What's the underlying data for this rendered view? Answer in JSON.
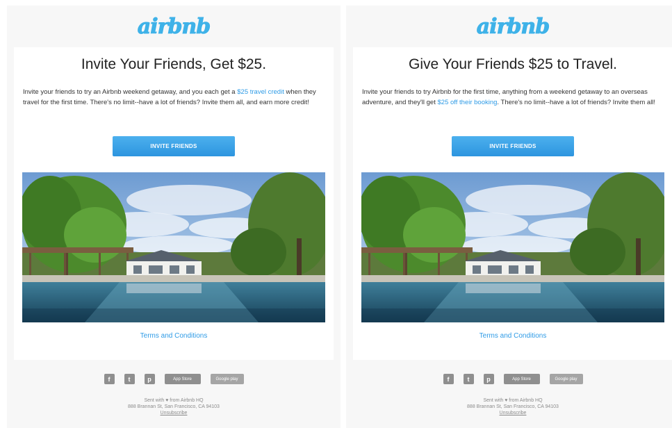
{
  "brand": {
    "logo_text": "airbnb",
    "color": "#3fb2e8",
    "link_color": "#2e9be6",
    "button_color": "#3aa2e6"
  },
  "emails": [
    {
      "headline": "Invite Your Friends, Get $25.",
      "body_before": "Invite your friends to try an Airbnb weekend getaway, and you each get a ",
      "body_link": "$25 travel credit",
      "body_after": " when they travel for the first time. There's no limit--have a lot of friends? Invite them all, and earn more credit!",
      "button_label": "INVITE FRIENDS",
      "terms_label": "Terms and Conditions"
    },
    {
      "headline": "Give Your Friends $25 to Travel.",
      "body_before": "Invite your friends to try Airbnb for the first time, anything from a weekend getaway to an overseas adventure, and they'll get ",
      "body_link": "$25 off their booking",
      "body_after": ". There's no limit--have a lot of friends? Invite them all!",
      "button_label": "INVITE FRIENDS",
      "terms_label": "Terms and Conditions"
    }
  ],
  "footer": {
    "social_icons": [
      "facebook-icon",
      "twitter-icon",
      "pinterest-icon"
    ],
    "facebook_glyph": "f",
    "twitter_glyph": "t",
    "pinterest_glyph": "p",
    "app_store_label": "App Store",
    "google_play_label": "Google play",
    "sent_line": "Sent with ♥ from Airbnb HQ",
    "address": "888 Brannan St, San Francisco, CA 94103",
    "unsubscribe": "Unsubscribe"
  }
}
